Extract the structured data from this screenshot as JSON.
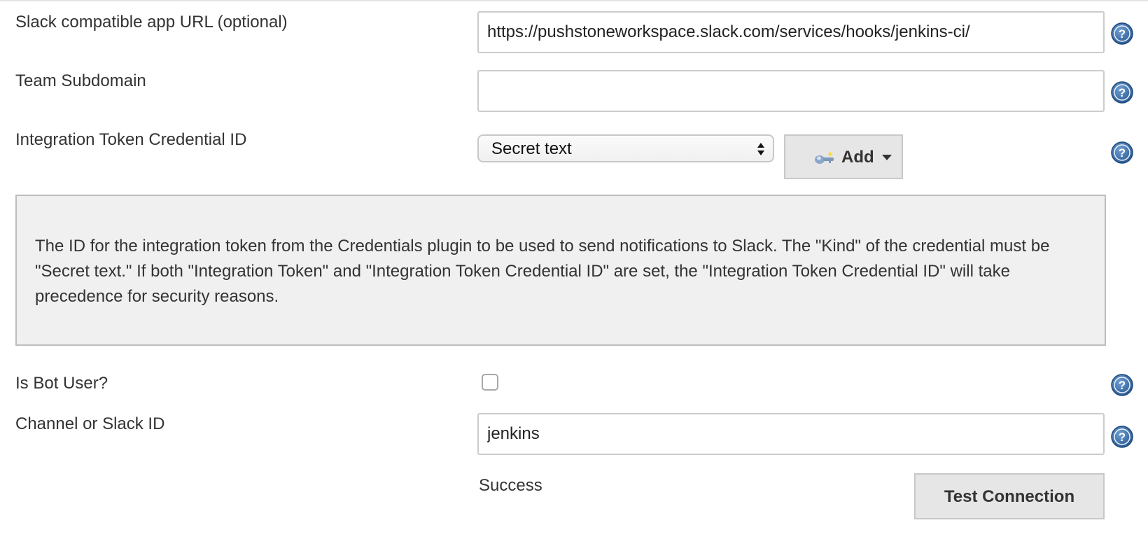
{
  "fields": {
    "app_url": {
      "label": "Slack compatible app URL (optional)",
      "value": "https://pushstoneworkspace.slack.com/services/hooks/jenkins-ci/"
    },
    "team_subdomain": {
      "label": "Team Subdomain",
      "value": ""
    },
    "credential_id": {
      "label": "Integration Token Credential ID",
      "selected": "Secret text",
      "add_label": "Add"
    },
    "credential_help": {
      "text": "The ID for the integration token from the Credentials plugin to be used to send notifications to Slack. The \"Kind\" of the credential must be \"Secret text.\" If both \"Integration Token\" and \"Integration Token Credential ID\" are set, the \"Integration Token Credential ID\" will take precedence for security reasons."
    },
    "bot_user": {
      "label": "Is Bot User?",
      "checked": false
    },
    "channel": {
      "label": "Channel or Slack ID",
      "value": "jenkins"
    }
  },
  "connection": {
    "status": "Success",
    "test_label": "Test Connection"
  },
  "icons": {
    "help": "help-icon",
    "key": "key-icon",
    "caret": "chevron-down-icon"
  },
  "colors": {
    "help_icon": "#3d6ea6",
    "panel_bg": "#f0f0f0",
    "button_bg": "#e6e6e6"
  }
}
